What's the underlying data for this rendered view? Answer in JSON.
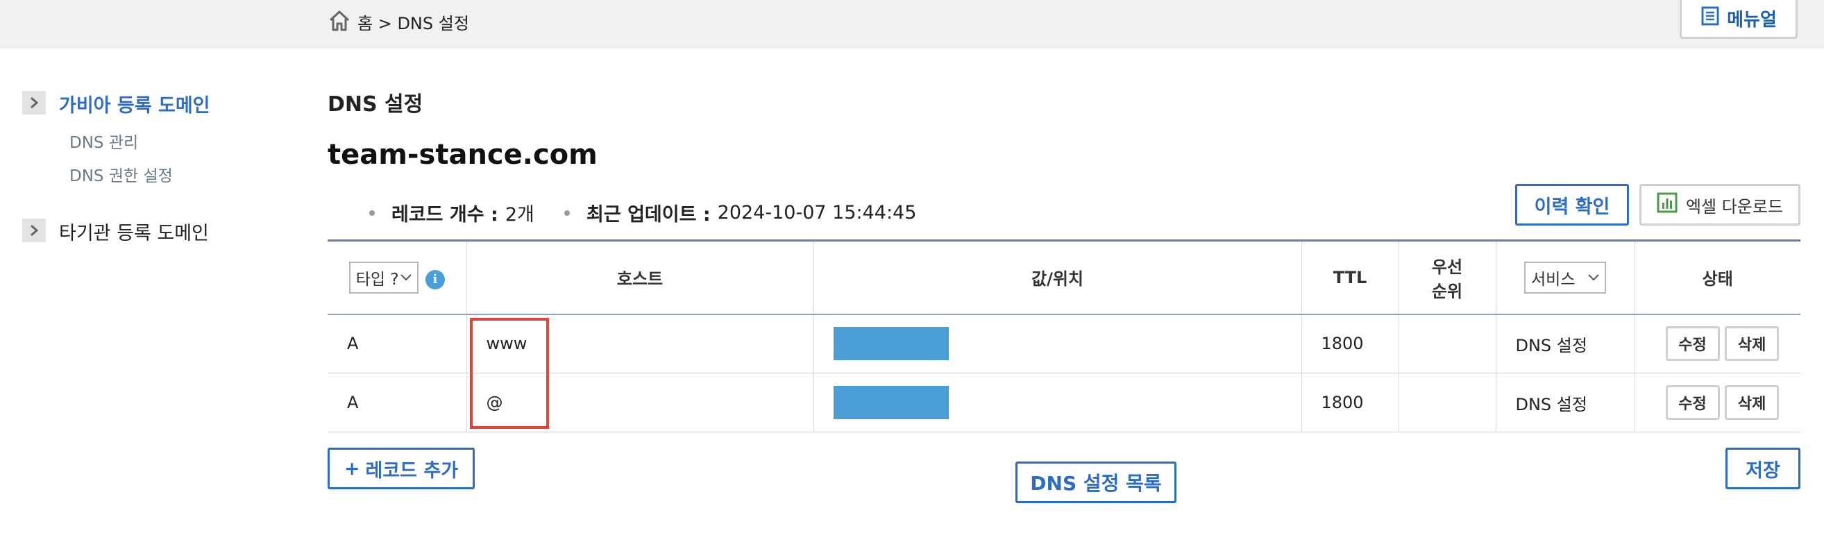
{
  "breadcrumb": {
    "home_icon": "home-icon",
    "text": "홈 > DNS 설정"
  },
  "header": {
    "manual_label": "메뉴얼",
    "manual_icon": "document-list-icon"
  },
  "sidebar": {
    "items": [
      {
        "label": "가비아 등록 도메인",
        "active": true,
        "arrow_icon": "chevron-right-icon",
        "subitems": [
          "DNS 관리",
          "DNS 권한 설정"
        ]
      },
      {
        "label": "타기관 등록 도메인",
        "active": false,
        "arrow_icon": "chevron-right-icon"
      }
    ]
  },
  "main": {
    "title": "DNS 설정",
    "domain": "team-stance.com",
    "stats": {
      "record_count_label": "레코드 개수 :",
      "record_count_value": "2개",
      "last_update_label": "최근 업데이트 :",
      "last_update_value": "2024-10-07 15:44:45"
    },
    "history_button": "이력 확인",
    "excel_button": "엑셀 다운로드",
    "excel_icon": "spreadsheet-chart-icon"
  },
  "table": {
    "headers": {
      "type_select": "타입 ?",
      "host": "호스트",
      "value": "값/위치",
      "ttl": "TTL",
      "priority_line1": "우선",
      "priority_line2": "순위",
      "service_select": "서비스",
      "status": "상태"
    },
    "rows": [
      {
        "type": "A",
        "host": "www",
        "ttl": "1800",
        "priority": "",
        "service": "DNS 설정",
        "edit": "수정",
        "delete": "삭제"
      },
      {
        "type": "A",
        "host": "@",
        "ttl": "1800",
        "priority": "",
        "service": "DNS 설정",
        "edit": "수정",
        "delete": "삭제"
      }
    ]
  },
  "footer": {
    "add_record_icon": "+",
    "add_record": "레코드 추가",
    "dns_list": "DNS 설정 목록",
    "save": "저장"
  },
  "colors": {
    "accent": "#2d6cc0",
    "value_redacted": "#4aa0d6",
    "highlight": "#e0453a",
    "topbar": "#f1f1f1"
  }
}
